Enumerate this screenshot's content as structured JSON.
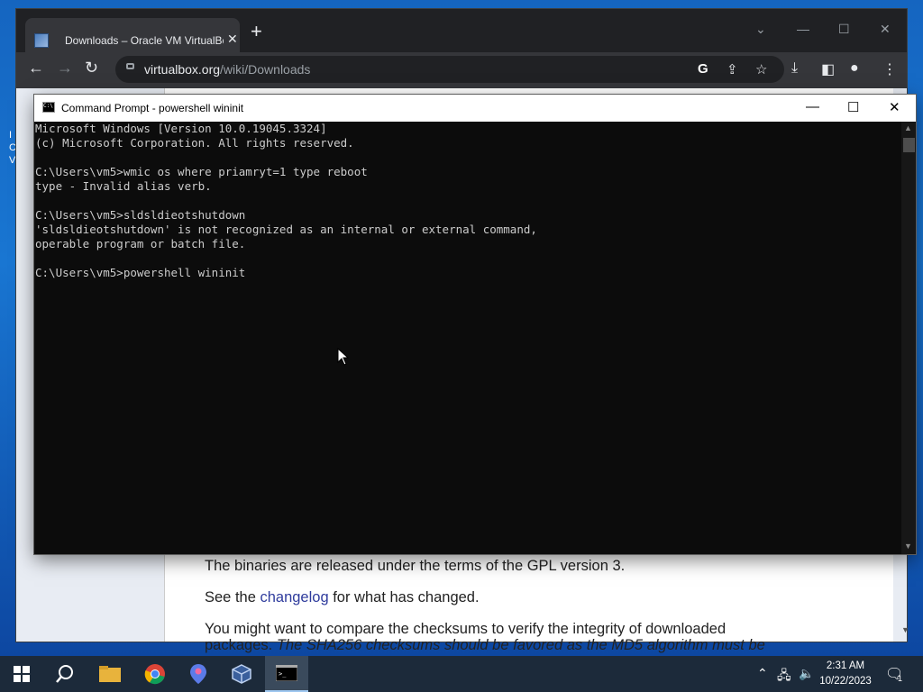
{
  "browser": {
    "tab_title": "Downloads – Oracle VM VirtualBox",
    "url_host": "virtualbox.org",
    "url_path": "/wiki/Downloads"
  },
  "page": {
    "line1": "The binaries are released under the terms of the GPL version 3.",
    "line2_pre": "See the ",
    "line2_link": "changelog",
    "line2_post": " for what has changed.",
    "line3": "You might want to compare the checksums to verify the integrity of downloaded",
    "line4_pre": "packages. ",
    "line4_em": "The SHA256 checksums should be favored as the MD5 algorithm must be"
  },
  "cmd": {
    "title": "Command Prompt - powershell  wininit",
    "lines": [
      "Microsoft Windows [Version 10.0.19045.3324]",
      "(c) Microsoft Corporation. All rights reserved.",
      "",
      "C:\\Users\\vm5>wmic os where priamryt=1 type reboot",
      "type - Invalid alias verb.",
      "",
      "C:\\Users\\vm5>sldsldieotshutdown",
      "'sldsldieotshutdown' is not recognized as an internal or external command,",
      "operable program or batch file.",
      "",
      "C:\\Users\\vm5>powershell wininit"
    ]
  },
  "taskbar": {
    "time": "2:31 AM",
    "date": "10/22/2023",
    "notification_count": "1"
  },
  "colors": {
    "link": "#2f3c9d",
    "console_bg": "#0c0c0c",
    "console_fg": "#cccccc"
  }
}
